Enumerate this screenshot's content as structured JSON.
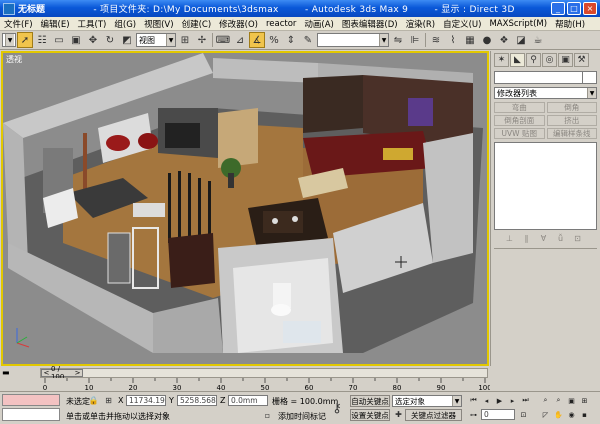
{
  "titlebar": {
    "doc_title": "无标题",
    "project_label": "- 项目文件夹: D:\\My Documents\\3dsmax",
    "app_title": "- Autodesk 3ds Max 9",
    "display_label": "- 显示 : Direct 3D",
    "minimize": "_",
    "maximize": "□",
    "close": "×"
  },
  "menu": [
    "文件(F)",
    "编辑(E)",
    "工具(T)",
    "组(G)",
    "视图(V)",
    "创建(C)",
    "修改器(O)",
    "reactor",
    "动画(A)",
    "图表编辑器(D)",
    "渲染(R)",
    "自定义(U)",
    "MAXScript(M)",
    "帮助(H)"
  ],
  "toolbar": {
    "view_combo": "视图",
    "named_selection": ""
  },
  "viewport": {
    "label": "透视"
  },
  "command_panel": {
    "modifier_list": "修改器列表",
    "buttons": [
      "弯曲",
      "倒角",
      "倒角剖面",
      "挤出",
      "UVW 贴图",
      "编辑样条线"
    ]
  },
  "time_slider": {
    "frame_label": "0 / 100",
    "prev": "<",
    "next": ">"
  },
  "trackbar": {
    "ticks": [
      "0",
      "10",
      "20",
      "30",
      "40",
      "50",
      "60",
      "70",
      "80",
      "90",
      "100"
    ]
  },
  "status": {
    "selection": "未选定",
    "x_label": "X",
    "x_value": "11734.195",
    "y_label": "Y",
    "y_value": "5258.568n",
    "z_label": "Z",
    "z_value": "0.0mm",
    "grid": "栅格 = 100.0mm",
    "prompt": "单击或单击并拖动以选择对象",
    "add_time_tag": "添加时间标记",
    "auto_key": "自动关键点",
    "set_key": "设置关键点",
    "key_filter": "关键点过滤器",
    "selected_object": "选定对象",
    "frame": "0"
  }
}
